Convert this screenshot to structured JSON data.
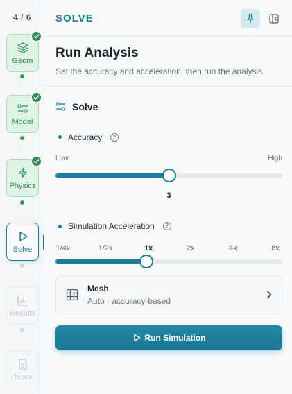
{
  "rail": {
    "step_count": "4 / 6",
    "steps": [
      {
        "label": "Geom",
        "icon": "layers-icon",
        "state": "done"
      },
      {
        "label": "Model",
        "icon": "sliders-icon",
        "state": "done"
      },
      {
        "label": "Physics",
        "icon": "lightning-icon",
        "state": "done"
      },
      {
        "label": "Solve",
        "icon": "play-icon",
        "state": "active"
      },
      {
        "label": "Results",
        "icon": "bar-chart-icon",
        "state": "locked"
      },
      {
        "label": "Report",
        "icon": "document-icon",
        "state": "locked"
      }
    ]
  },
  "topbar": {
    "title": "SOLVE",
    "pin_icon": "pin-icon",
    "panel_icon": "collapse-panel-icon"
  },
  "header": {
    "title": "Run Analysis",
    "subtitle": "Set the accuracy and acceleration, then run the analysis."
  },
  "section": {
    "title": "Solve",
    "icon": "sliders-icon"
  },
  "accuracy": {
    "label": "Accuracy",
    "min_label": "Low",
    "max_label": "High",
    "value": 3,
    "min": 1,
    "max": 5
  },
  "acceleration": {
    "label": "Simulation Acceleration",
    "options": [
      "1/4x",
      "1/2x",
      "1x",
      "2x",
      "4x",
      "8x"
    ],
    "selected_index": 2
  },
  "mesh": {
    "title": "Mesh",
    "subtitle": "Auto · accuracy-based",
    "icon": "grid-icon"
  },
  "run": {
    "label": "Run Simulation",
    "icon": "play-icon"
  },
  "colors": {
    "accent": "#1a7f9c",
    "done": "#2f8a50",
    "done_bg": "#dff3e6"
  }
}
